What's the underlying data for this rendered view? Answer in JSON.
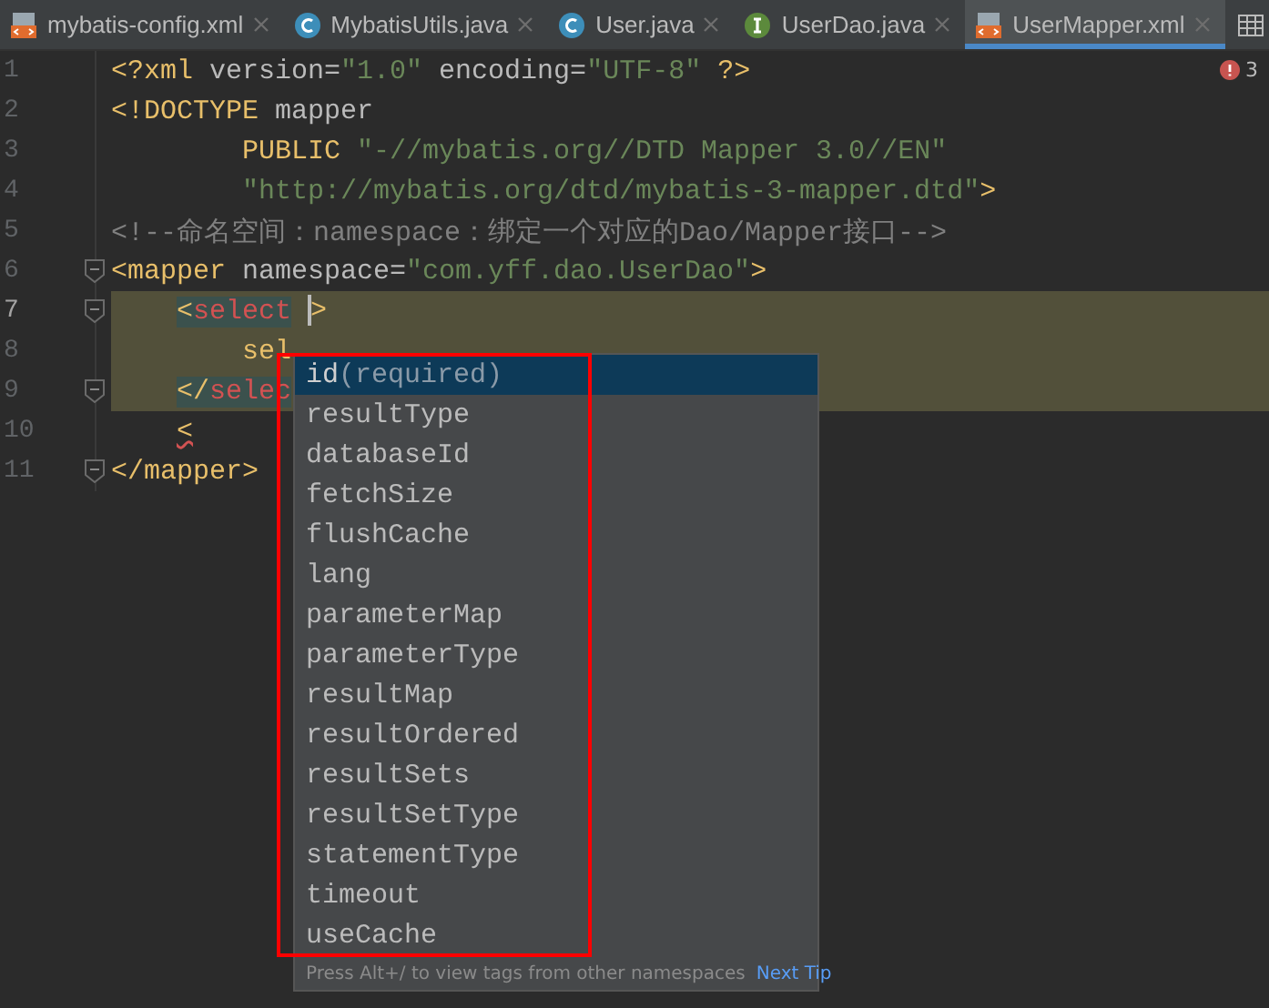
{
  "tabs": [
    {
      "label": "mybatis-config.xml",
      "kind": "xml",
      "selected": false
    },
    {
      "label": "MybatisUtils.java",
      "kind": "class",
      "selected": false
    },
    {
      "label": "User.java",
      "kind": "class",
      "selected": false
    },
    {
      "label": "UserDao.java",
      "kind": "interface",
      "selected": false
    },
    {
      "label": "UserMapper.xml",
      "kind": "xml",
      "selected": true
    }
  ],
  "problems": {
    "count": "3"
  },
  "editor": {
    "lines": [
      {
        "number": "1",
        "kind": "top",
        "current": false,
        "highlighted": false,
        "fold": false,
        "segments": [
          {
            "text": "<?xml ",
            "kind": "tag"
          },
          {
            "text": "version=",
            "kind": "attr"
          },
          {
            "text": "\"1.0\"",
            "kind": "value"
          },
          {
            "text": " encoding=",
            "kind": "attr"
          },
          {
            "text": "\"UTF-8\"",
            "kind": "value"
          },
          {
            "text": " ?>",
            "kind": "tag"
          }
        ]
      },
      {
        "number": "2",
        "kind": "top",
        "current": false,
        "highlighted": false,
        "fold": false,
        "segments": [
          {
            "text": "<!DOCTYPE ",
            "kind": "tag"
          },
          {
            "text": "mapper",
            "kind": "attr"
          }
        ]
      },
      {
        "number": "3",
        "kind": "inner",
        "current": false,
        "highlighted": false,
        "fold": false,
        "segments": [
          {
            "text": "PUBLIC ",
            "kind": "tag"
          },
          {
            "text": "\"-//mybatis.org//DTD Mapper 3.0//EN\"",
            "kind": "value"
          }
        ]
      },
      {
        "number": "4",
        "kind": "inner",
        "current": false,
        "highlighted": false,
        "fold": false,
        "segments": [
          {
            "text": "\"http://mybatis.org/dtd/mybatis-3-mapper.dtd\"",
            "kind": "value"
          },
          {
            "text": ">",
            "kind": "tag"
          }
        ]
      },
      {
        "number": "5",
        "kind": "top",
        "current": false,
        "highlighted": false,
        "fold": false,
        "segments": [
          {
            "text": "<!--命名空间：namespace：绑定一个对应的Dao/Mapper接口-->",
            "kind": "comment"
          }
        ]
      },
      {
        "number": "6",
        "kind": "top",
        "current": false,
        "highlighted": false,
        "fold": true,
        "segments": [
          {
            "text": "<mapper ",
            "kind": "tag"
          },
          {
            "text": "namespace=",
            "kind": "attr"
          },
          {
            "text": "\"com.yff.dao.UserDao\"",
            "kind": "value"
          },
          {
            "text": ">",
            "kind": "tag"
          }
        ]
      },
      {
        "number": "7",
        "kind": "child",
        "current": true,
        "highlighted": true,
        "fold": true,
        "segments": [
          {
            "text": "<",
            "kind": "tag",
            "matched": true
          },
          {
            "text": "select",
            "kind": "error",
            "matched": true
          },
          {
            "text": " >",
            "kind": "tag",
            "caret": true
          }
        ]
      },
      {
        "number": "8",
        "kind": "inner",
        "current": false,
        "highlighted": true,
        "fold": false,
        "segments": [
          {
            "text": "sel",
            "kind": "tag"
          }
        ]
      },
      {
        "number": "9",
        "kind": "child",
        "current": false,
        "highlighted": true,
        "fold": true,
        "segments": [
          {
            "text": "</",
            "kind": "tag",
            "matched": true
          },
          {
            "text": "selec",
            "kind": "error",
            "matched": true
          }
        ]
      },
      {
        "number": "10",
        "kind": "child",
        "current": false,
        "highlighted": false,
        "fold": false,
        "segments": [
          {
            "text": "<",
            "kind": "tag",
            "squiggle": true
          }
        ]
      },
      {
        "number": "11",
        "kind": "top",
        "current": false,
        "highlighted": false,
        "fold": true,
        "segments": [
          {
            "text": "</mapper>",
            "kind": "tag"
          }
        ]
      }
    ]
  },
  "completion": {
    "items": [
      {
        "label": "id",
        "hint": "(required)",
        "selected": true
      },
      {
        "label": "resultType",
        "selected": false
      },
      {
        "label": "databaseId",
        "selected": false
      },
      {
        "label": "fetchSize",
        "selected": false
      },
      {
        "label": "flushCache",
        "selected": false
      },
      {
        "label": "lang",
        "selected": false
      },
      {
        "label": "parameterMap",
        "selected": false
      },
      {
        "label": "parameterType",
        "selected": false
      },
      {
        "label": "resultMap",
        "selected": false
      },
      {
        "label": "resultOrdered",
        "selected": false
      },
      {
        "label": "resultSets",
        "selected": false
      },
      {
        "label": "resultSetType",
        "selected": false
      },
      {
        "label": "statementType",
        "selected": false
      },
      {
        "label": "timeout",
        "selected": false
      },
      {
        "label": "useCache",
        "selected": false
      }
    ],
    "footer": {
      "text": "Press Alt+/ to view tags from other namespaces",
      "link": "Next Tip"
    }
  }
}
